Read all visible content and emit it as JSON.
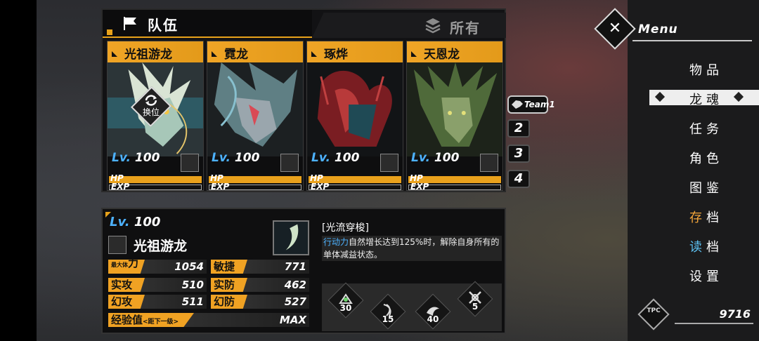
{
  "tabs": {
    "team": "队伍",
    "all": "所有"
  },
  "team_buttons": {
    "team1": "Team1",
    "b2": "2",
    "b3": "3",
    "b4": "4"
  },
  "cards": [
    {
      "name": "光祖游龙",
      "lv_label": "Lv.",
      "lv": "100",
      "hp": "HP",
      "exp": "EXP",
      "swap_label": "换位"
    },
    {
      "name": "霓龙",
      "lv_label": "Lv.",
      "lv": "100",
      "hp": "HP",
      "exp": "EXP"
    },
    {
      "name": "琢烨",
      "lv_label": "Lv.",
      "lv": "100",
      "hp": "HP",
      "exp": "EXP"
    },
    {
      "name": "天恩龙",
      "lv_label": "Lv.",
      "lv": "100",
      "hp": "HP",
      "exp": "EXP"
    }
  ],
  "detail": {
    "lv_label": "Lv.",
    "lv": "100",
    "name": "光祖游龙",
    "stats": {
      "max_hp_label_small": "最大体",
      "max_hp_label_big": "力",
      "max_hp": "1054",
      "agility_label": "敏捷",
      "agility": "771",
      "atk_label": "实攻",
      "atk": "510",
      "def_label": "实防",
      "def": "462",
      "matk_label": "幻攻",
      "matk": "511",
      "mdef_label": "幻防",
      "mdef": "527",
      "exp_label": "经验值",
      "exp_sub": "<距下一级>",
      "exp_value": "MAX"
    },
    "skill_title": "[光流穿梭]",
    "skill_keyword": "行动力",
    "skill_desc": "自然增长达到125%时，解除自身所有的单体减益状态。",
    "skill_nums": [
      "30",
      "15",
      "40",
      "5"
    ]
  },
  "menu": {
    "title": "Menu",
    "items": [
      "物品",
      "龙魂",
      "任务",
      "角色",
      "图鉴",
      "存档",
      "读档",
      "设置"
    ],
    "currency_label": "TPC",
    "currency_value": "9716"
  },
  "colors": {
    "accent": "#e8a21a",
    "level_blue": "#4db2ff",
    "save_orange": "#f3a53a",
    "load_blue": "#5cc1f2"
  }
}
